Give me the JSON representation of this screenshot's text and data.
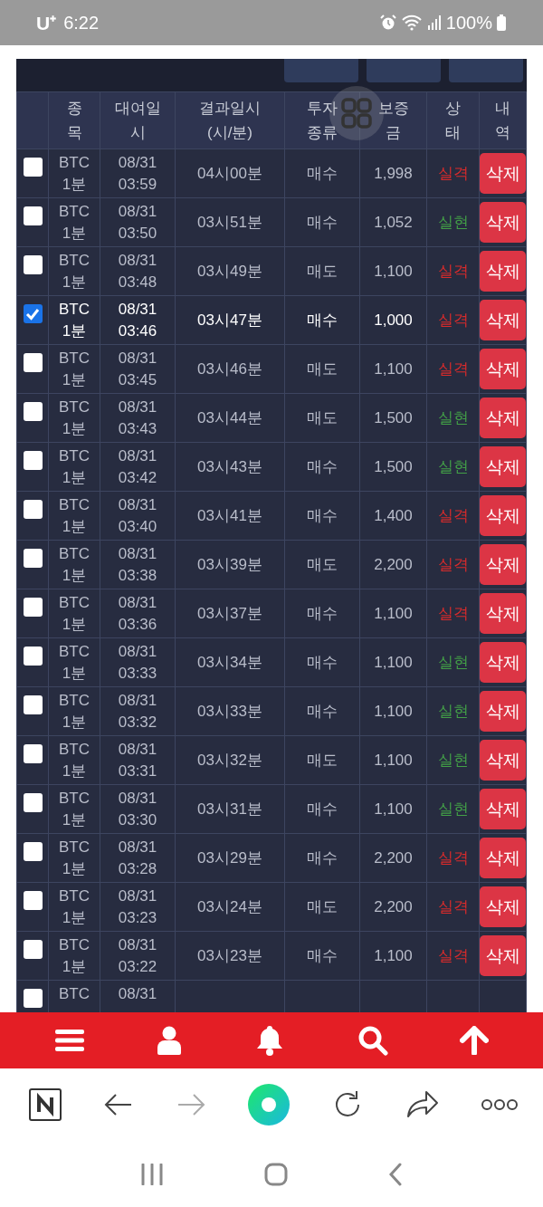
{
  "status_bar": {
    "carrier": "U⁺",
    "time": "6:22",
    "battery": "100%"
  },
  "table": {
    "columns": [
      "종\n목",
      "대여일\n시",
      "결과일시\n(시/분)",
      "투자\n종류",
      "보증\n금",
      "상\n태",
      "내\n역"
    ],
    "rows": [
      {
        "checked": false,
        "symbol": "BTC",
        "period": "1분",
        "date": "08/31",
        "time": "03:59",
        "result_time": "04시00분",
        "side": "매수",
        "amount": "1,998",
        "status": "실격",
        "color": "#d92b2b",
        "action": "삭제"
      },
      {
        "checked": false,
        "symbol": "BTC",
        "period": "1분",
        "date": "08/31",
        "time": "03:50",
        "result_time": "03시51분",
        "side": "매수",
        "amount": "1,052",
        "status": "실현",
        "color": "#43a047",
        "action": "삭제"
      },
      {
        "checked": false,
        "symbol": "BTC",
        "period": "1분",
        "date": "08/31",
        "time": "03:48",
        "result_time": "03시49분",
        "side": "매도",
        "amount": "1,100",
        "status": "실격",
        "color": "#d92b2b",
        "action": "삭제"
      },
      {
        "checked": true,
        "symbol": "BTC",
        "period": "1분",
        "date": "08/31",
        "time": "03:46",
        "result_time": "03시47분",
        "side": "매수",
        "amount": "1,000",
        "status": "실격",
        "color": "#d92b2b",
        "action": "삭제"
      },
      {
        "checked": false,
        "symbol": "BTC",
        "period": "1분",
        "date": "08/31",
        "time": "03:45",
        "result_time": "03시46분",
        "side": "매도",
        "amount": "1,100",
        "status": "실격",
        "color": "#d92b2b",
        "action": "삭제"
      },
      {
        "checked": false,
        "symbol": "BTC",
        "period": "1분",
        "date": "08/31",
        "time": "03:43",
        "result_time": "03시44분",
        "side": "매도",
        "amount": "1,500",
        "status": "실현",
        "color": "#43a047",
        "action": "삭제"
      },
      {
        "checked": false,
        "symbol": "BTC",
        "period": "1분",
        "date": "08/31",
        "time": "03:42",
        "result_time": "03시43분",
        "side": "매수",
        "amount": "1,500",
        "status": "실현",
        "color": "#43a047",
        "action": "삭제"
      },
      {
        "checked": false,
        "symbol": "BTC",
        "period": "1분",
        "date": "08/31",
        "time": "03:40",
        "result_time": "03시41분",
        "side": "매수",
        "amount": "1,400",
        "status": "실격",
        "color": "#d92b2b",
        "action": "삭제"
      },
      {
        "checked": false,
        "symbol": "BTC",
        "period": "1분",
        "date": "08/31",
        "time": "03:38",
        "result_time": "03시39분",
        "side": "매도",
        "amount": "2,200",
        "status": "실격",
        "color": "#d92b2b",
        "action": "삭제"
      },
      {
        "checked": false,
        "symbol": "BTC",
        "period": "1분",
        "date": "08/31",
        "time": "03:36",
        "result_time": "03시37분",
        "side": "매수",
        "amount": "1,100",
        "status": "실격",
        "color": "#d92b2b",
        "action": "삭제"
      },
      {
        "checked": false,
        "symbol": "BTC",
        "period": "1분",
        "date": "08/31",
        "time": "03:33",
        "result_time": "03시34분",
        "side": "매수",
        "amount": "1,100",
        "status": "실현",
        "color": "#43a047",
        "action": "삭제"
      },
      {
        "checked": false,
        "symbol": "BTC",
        "period": "1분",
        "date": "08/31",
        "time": "03:32",
        "result_time": "03시33분",
        "side": "매수",
        "amount": "1,100",
        "status": "실현",
        "color": "#43a047",
        "action": "삭제"
      },
      {
        "checked": false,
        "symbol": "BTC",
        "period": "1분",
        "date": "08/31",
        "time": "03:31",
        "result_time": "03시32분",
        "side": "매도",
        "amount": "1,100",
        "status": "실현",
        "color": "#43a047",
        "action": "삭제"
      },
      {
        "checked": false,
        "symbol": "BTC",
        "period": "1분",
        "date": "08/31",
        "time": "03:30",
        "result_time": "03시31분",
        "side": "매수",
        "amount": "1,100",
        "status": "실현",
        "color": "#43a047",
        "action": "삭제"
      },
      {
        "checked": false,
        "symbol": "BTC",
        "period": "1분",
        "date": "08/31",
        "time": "03:28",
        "result_time": "03시29분",
        "side": "매수",
        "amount": "2,200",
        "status": "실격",
        "color": "#d92b2b",
        "action": "삭제"
      },
      {
        "checked": false,
        "symbol": "BTC",
        "period": "1분",
        "date": "08/31",
        "time": "03:23",
        "result_time": "03시24분",
        "side": "매도",
        "amount": "2,200",
        "status": "실격",
        "color": "#d92b2b",
        "action": "삭제"
      },
      {
        "checked": false,
        "symbol": "BTC",
        "period": "1분",
        "date": "08/31",
        "time": "03:22",
        "result_time": "03시23분",
        "side": "매수",
        "amount": "1,100",
        "status": "실격",
        "color": "#d92b2b",
        "action": "삭제"
      },
      {
        "checked": false,
        "symbol": "BTC",
        "date": "08/31"
      }
    ]
  }
}
